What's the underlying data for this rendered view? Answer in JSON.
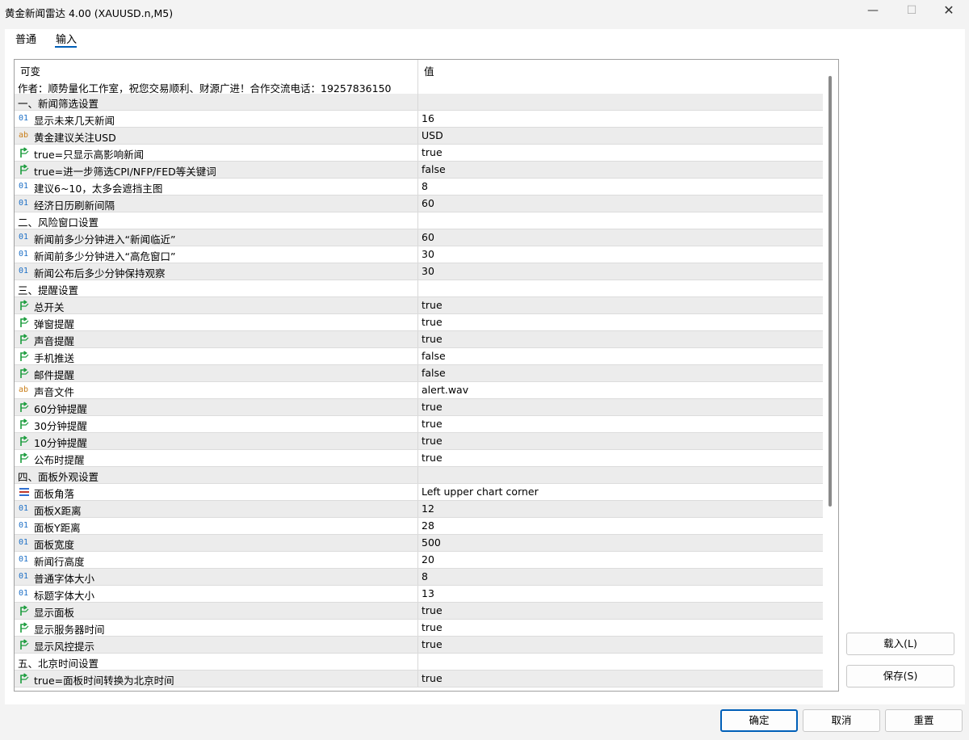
{
  "window": {
    "title": "黄金新闻雷达 4.00 (XAUUSD.n,M5)",
    "minimize_label": "—",
    "maximize_label": "☐",
    "close_label": "✕"
  },
  "tabs": [
    {
      "label": "普通",
      "active": false
    },
    {
      "label": "输入",
      "active": true
    }
  ],
  "grid": {
    "header": {
      "col_variable": "可变",
      "col_value": "值"
    },
    "author_line": "作者：顺势量化工作室，祝您交易顺利、财源广进！合作交流电话：19257836150",
    "rows": [
      {
        "type": "section",
        "label": "一、新闻筛选设置",
        "value": ""
      },
      {
        "type": "int",
        "label": "显示未来几天新闻",
        "value": "16"
      },
      {
        "type": "string",
        "label": "黄金建议关注USD",
        "value": "USD"
      },
      {
        "type": "bool",
        "label": "true=只显示高影响新闻",
        "value": "true"
      },
      {
        "type": "bool",
        "label": "true=进一步筛选CPI/NFP/FED等关键词",
        "value": "false"
      },
      {
        "type": "int",
        "label": "建议6~10，太多会遮挡主图",
        "value": "8"
      },
      {
        "type": "int",
        "label": "经济日历刷新间隔",
        "value": "60"
      },
      {
        "type": "section",
        "label": "二、风险窗口设置",
        "value": ""
      },
      {
        "type": "int",
        "label": "新闻前多少分钟进入“新闻临近”",
        "value": "60"
      },
      {
        "type": "int",
        "label": "新闻前多少分钟进入“高危窗口”",
        "value": "30"
      },
      {
        "type": "int",
        "label": "新闻公布后多少分钟保持观察",
        "value": "30"
      },
      {
        "type": "section",
        "label": "三、提醒设置",
        "value": ""
      },
      {
        "type": "bool",
        "label": "总开关",
        "value": "true"
      },
      {
        "type": "bool",
        "label": "弹窗提醒",
        "value": "true"
      },
      {
        "type": "bool",
        "label": "声音提醒",
        "value": "true"
      },
      {
        "type": "bool",
        "label": "手机推送",
        "value": "false"
      },
      {
        "type": "bool",
        "label": "邮件提醒",
        "value": "false"
      },
      {
        "type": "string",
        "label": "声音文件",
        "value": "alert.wav"
      },
      {
        "type": "bool",
        "label": "60分钟提醒",
        "value": "true"
      },
      {
        "type": "bool",
        "label": "30分钟提醒",
        "value": "true"
      },
      {
        "type": "bool",
        "label": "10分钟提醒",
        "value": "true"
      },
      {
        "type": "bool",
        "label": "公布时提醒",
        "value": "true"
      },
      {
        "type": "section",
        "label": "四、面板外观设置",
        "value": ""
      },
      {
        "type": "enum",
        "label": "面板角落",
        "value": "Left upper chart corner"
      },
      {
        "type": "int",
        "label": "面板X距离",
        "value": "12"
      },
      {
        "type": "int",
        "label": "面板Y距离",
        "value": "28"
      },
      {
        "type": "int",
        "label": "面板宽度",
        "value": "500"
      },
      {
        "type": "int",
        "label": "新闻行高度",
        "value": "20"
      },
      {
        "type": "int",
        "label": "普通字体大小",
        "value": "8"
      },
      {
        "type": "int",
        "label": "标题字体大小",
        "value": "13"
      },
      {
        "type": "bool",
        "label": "显示面板",
        "value": "true"
      },
      {
        "type": "bool",
        "label": "显示服务器时间",
        "value": "true"
      },
      {
        "type": "bool",
        "label": "显示风控提示",
        "value": "true"
      },
      {
        "type": "section",
        "label": "五、北京时间设置",
        "value": ""
      },
      {
        "type": "bool",
        "label": "true=面板时间转换为北京时间",
        "value": "true"
      }
    ]
  },
  "icons": {
    "int": {
      "name": "integer-icon",
      "glyph": "01",
      "color": "#1c6fc6"
    },
    "string": {
      "name": "string-icon",
      "glyph": "ab",
      "color": "#c97d17"
    },
    "bool": {
      "name": "bool-icon",
      "color": "#1a9c3c"
    },
    "enum": {
      "name": "enum-icon",
      "color": "#2f6fd0"
    }
  },
  "buttons": {
    "load": "载入(L)",
    "save": "保存(S)",
    "ok": "确定",
    "cancel": "取消",
    "reset": "重置"
  },
  "colors": {
    "accent": "#005fb8",
    "row_alt": "#ececec"
  }
}
